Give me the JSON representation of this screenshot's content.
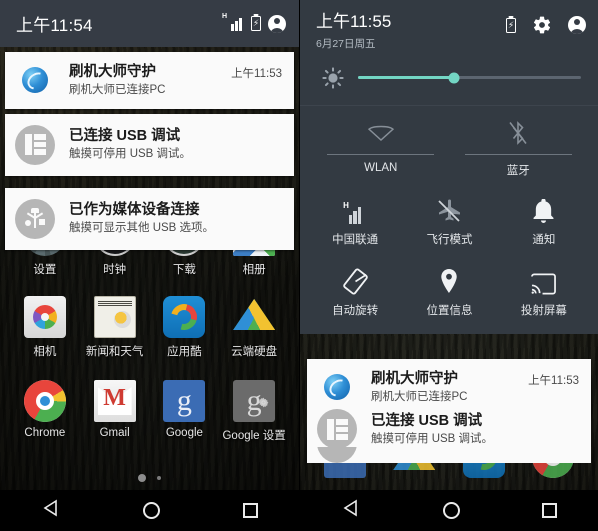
{
  "left_phone": {
    "statusbar": {
      "clock": "上午11:54",
      "icons": [
        "signal-icon",
        "battery-charging-icon",
        "account-avatar-icon"
      ],
      "signal_badge": "H",
      "background": "#363c45"
    },
    "notifications": [
      {
        "icon": "shuaji-master-icon",
        "title": "刷机大师守护",
        "subtitle": "刷机大师已连接PC",
        "time": "上午11:53"
      },
      {
        "icon": "usb-debug-icon",
        "title": "已连接 USB 调试",
        "subtitle": "触摸可停用 USB 调试。",
        "time": ""
      },
      {
        "icon": "usb-icon",
        "title": "已作为媒体设备连接",
        "subtitle": "触摸可显示其他 USB 选项。",
        "time": ""
      }
    ],
    "apps_row1": [
      {
        "icon": "settings-icon",
        "label": "设置"
      },
      {
        "icon": "clock-icon",
        "label": "时钟"
      },
      {
        "icon": "download-icon",
        "label": "下载"
      },
      {
        "icon": "photos-icon",
        "label": "相册"
      }
    ],
    "apps_row2": [
      {
        "icon": "camera-icon",
        "label": "相机"
      },
      {
        "icon": "news-weather-icon",
        "label": "新闻和天气"
      },
      {
        "icon": "yingyongku-icon",
        "label": "应用酷"
      },
      {
        "icon": "drive-icon",
        "label": "云端硬盘"
      }
    ],
    "apps_row3": [
      {
        "icon": "chrome-icon",
        "label": "Chrome"
      },
      {
        "icon": "gmail-icon",
        "label": "Gmail"
      },
      {
        "icon": "google-icon",
        "label": "Google",
        "glyph": "g"
      },
      {
        "icon": "google-settings-icon",
        "label": "Google 设置",
        "glyph": "g"
      }
    ],
    "page_dots": {
      "count": 2,
      "active": 0
    },
    "navbar": [
      "back-icon",
      "home-icon",
      "recents-icon"
    ]
  },
  "right_phone": {
    "quick_settings": {
      "clock": "上午11:55",
      "date": "6月27日周五",
      "header_icons": [
        "battery-charging-icon",
        "gear-icon",
        "account-avatar-icon"
      ],
      "brightness": {
        "icon": "brightness-icon",
        "value_percent": 43,
        "fill_color": "#73d6c4",
        "track_color": "#5c6570"
      },
      "wide_tiles": [
        {
          "icon": "wifi-off-icon",
          "label": "WLAN",
          "enabled": false
        },
        {
          "icon": "bluetooth-off-icon",
          "label": "蓝牙",
          "enabled": false
        }
      ],
      "tiles": [
        {
          "icon": "cellular-signal-icon",
          "label": "中国联通",
          "badge": "H"
        },
        {
          "icon": "airplane-mode-off-icon",
          "label": "飞行模式"
        },
        {
          "icon": "notification-bell-icon",
          "label": "通知"
        },
        {
          "icon": "auto-rotate-icon",
          "label": "自动旋转"
        },
        {
          "icon": "location-pin-icon",
          "label": "位置信息"
        },
        {
          "icon": "cast-screen-icon",
          "label": "投射屏幕"
        }
      ],
      "background": "#333a42"
    },
    "notifications": [
      {
        "icon": "shuaji-master-icon",
        "title": "刷机大师守护",
        "subtitle": "刷机大师已连接PC",
        "time": "上午11:53"
      },
      {
        "icon": "usb-debug-icon",
        "title": "已连接 USB 调试",
        "subtitle": "触摸可停用 USB 调试。",
        "time": ""
      }
    ],
    "navbar": [
      "back-icon",
      "home-icon",
      "recents-icon"
    ]
  }
}
